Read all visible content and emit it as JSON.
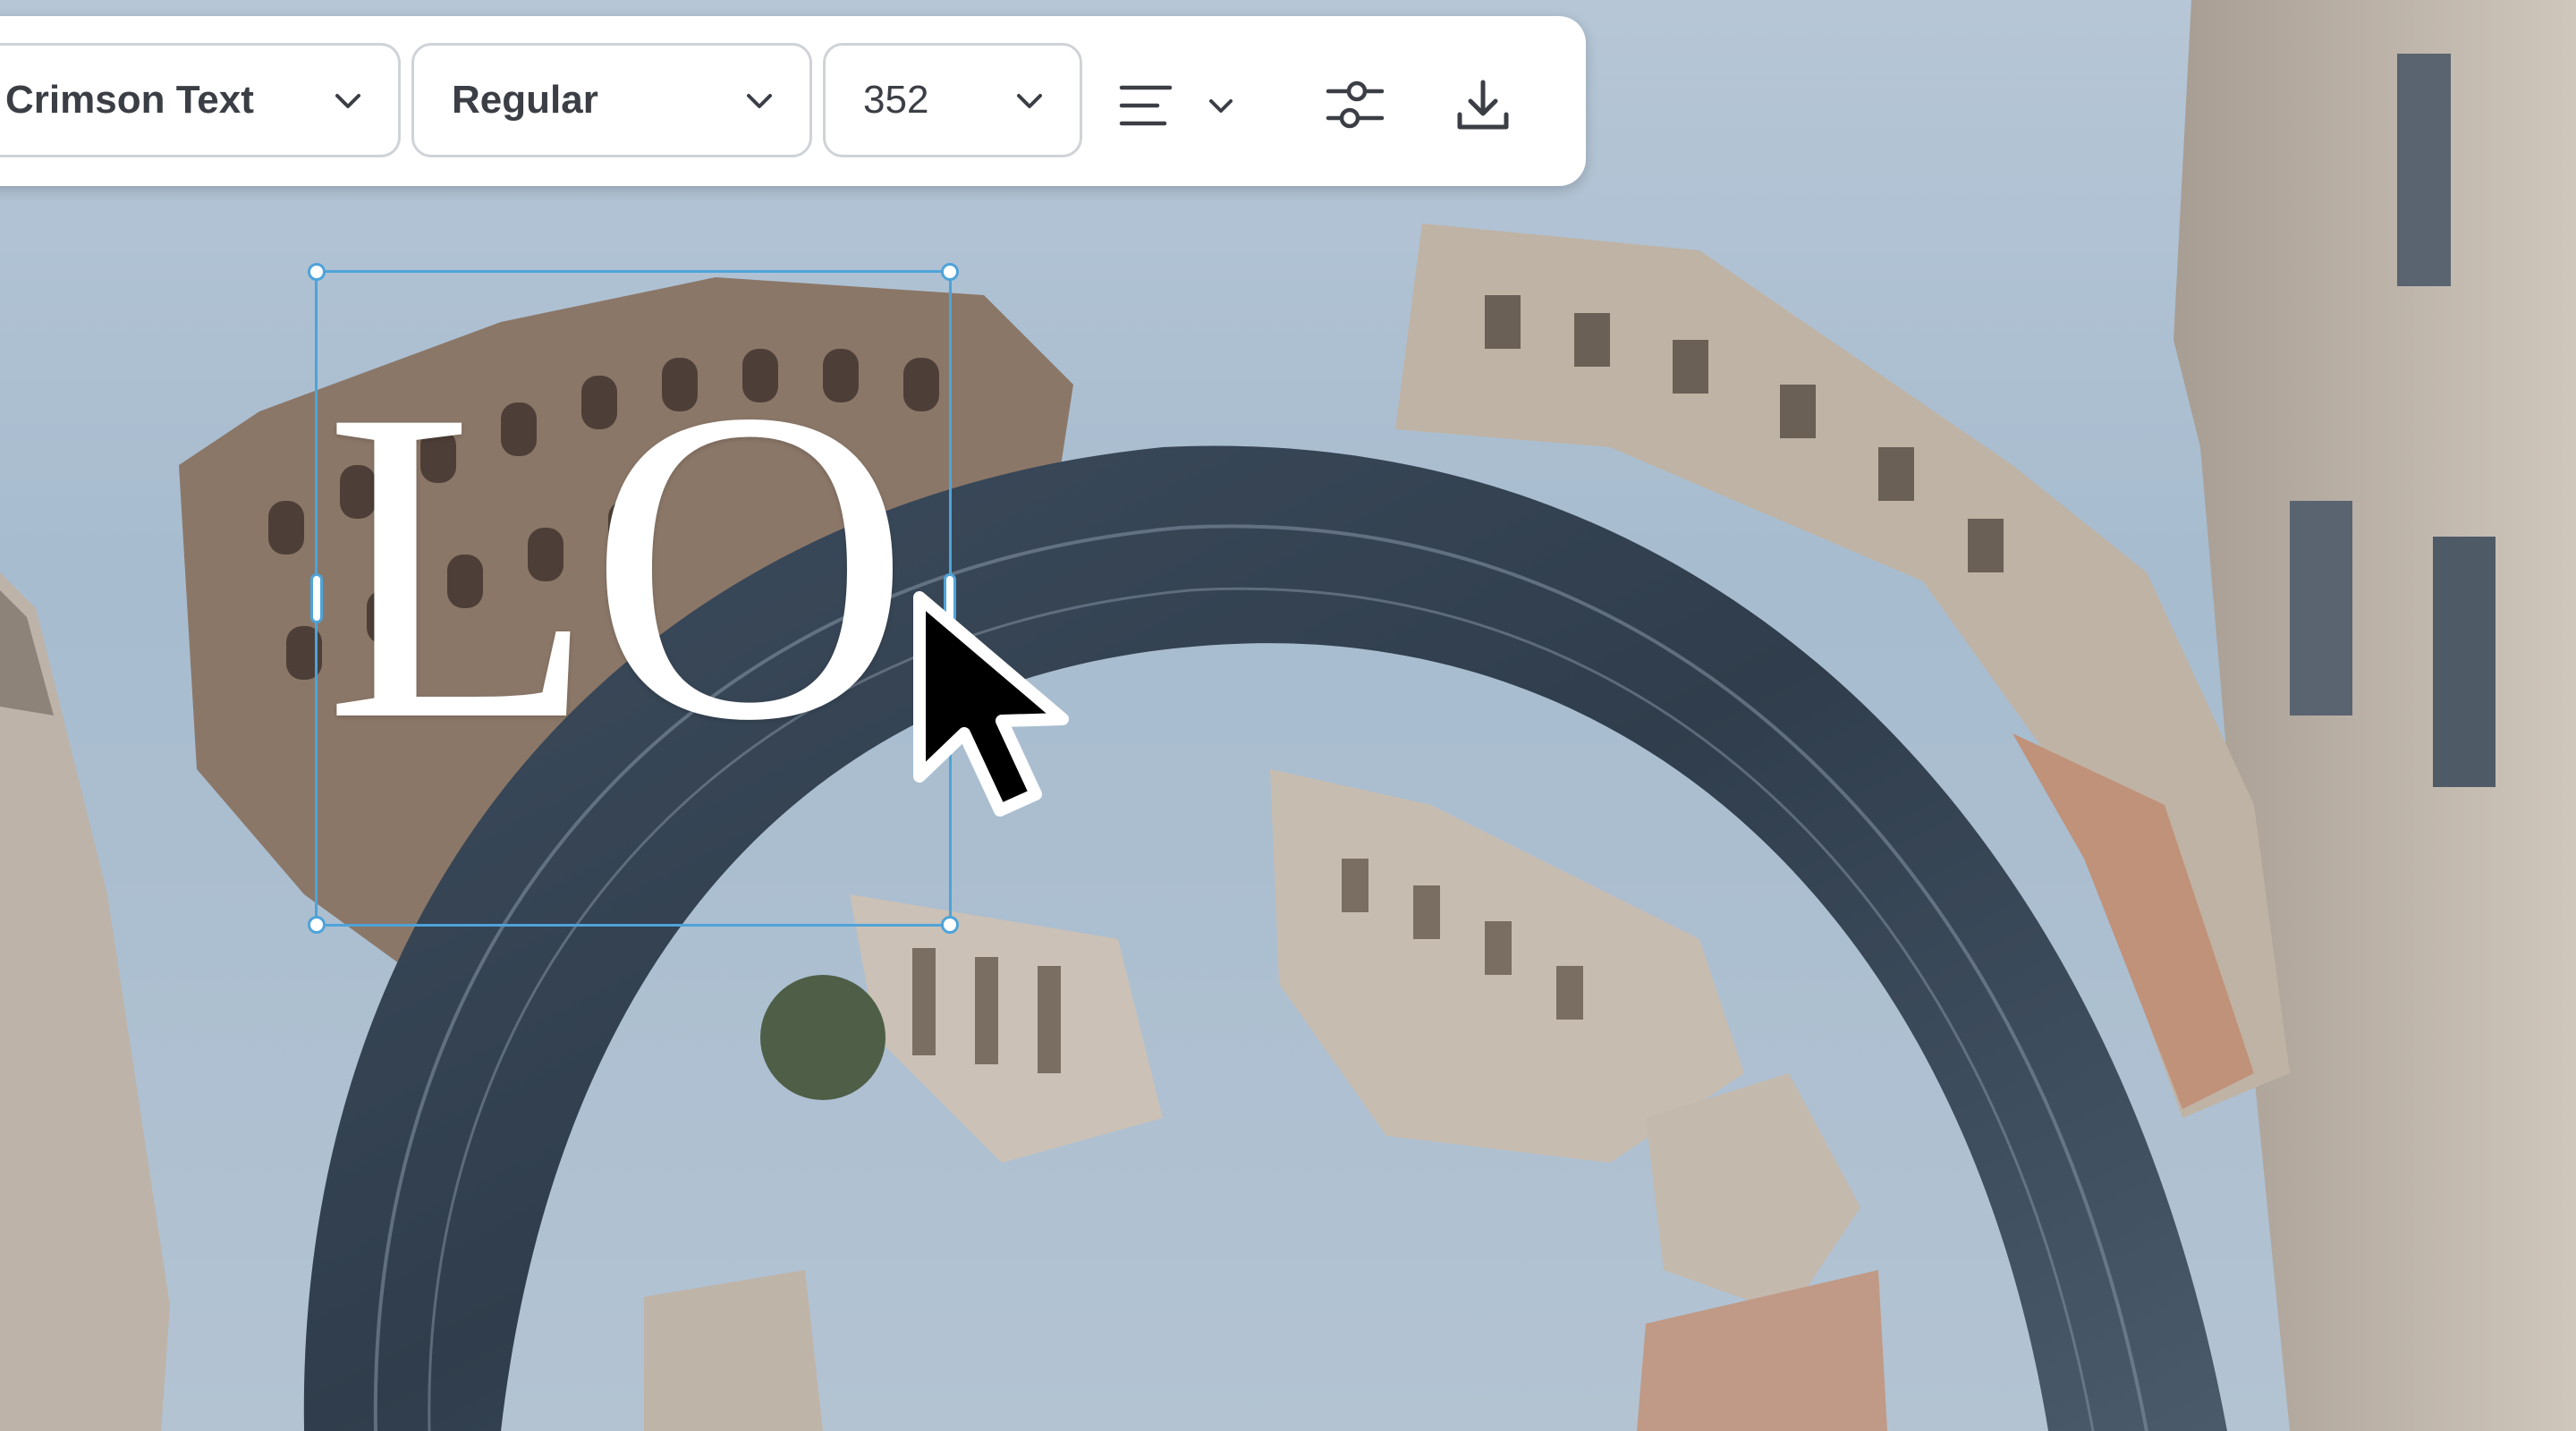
{
  "toolbar": {
    "font_family": "Crimson Text",
    "font_weight": "Regular",
    "font_size": "352",
    "icons": {
      "font_chevron": "chevron-down-icon",
      "weight_chevron": "chevron-down-icon",
      "size_chevron": "chevron-down-icon",
      "align": "align-left-icon",
      "align_chevron": "chevron-down-icon",
      "adjust": "sliders-icon",
      "download": "download-icon"
    }
  },
  "canvas": {
    "text_layer": "LO",
    "selection_color": "#4ea3d9"
  },
  "colors": {
    "toolbar_bg": "#ffffff",
    "border": "#cfd3d8",
    "text": "#3b3f45",
    "sky": "#a9bccd"
  }
}
